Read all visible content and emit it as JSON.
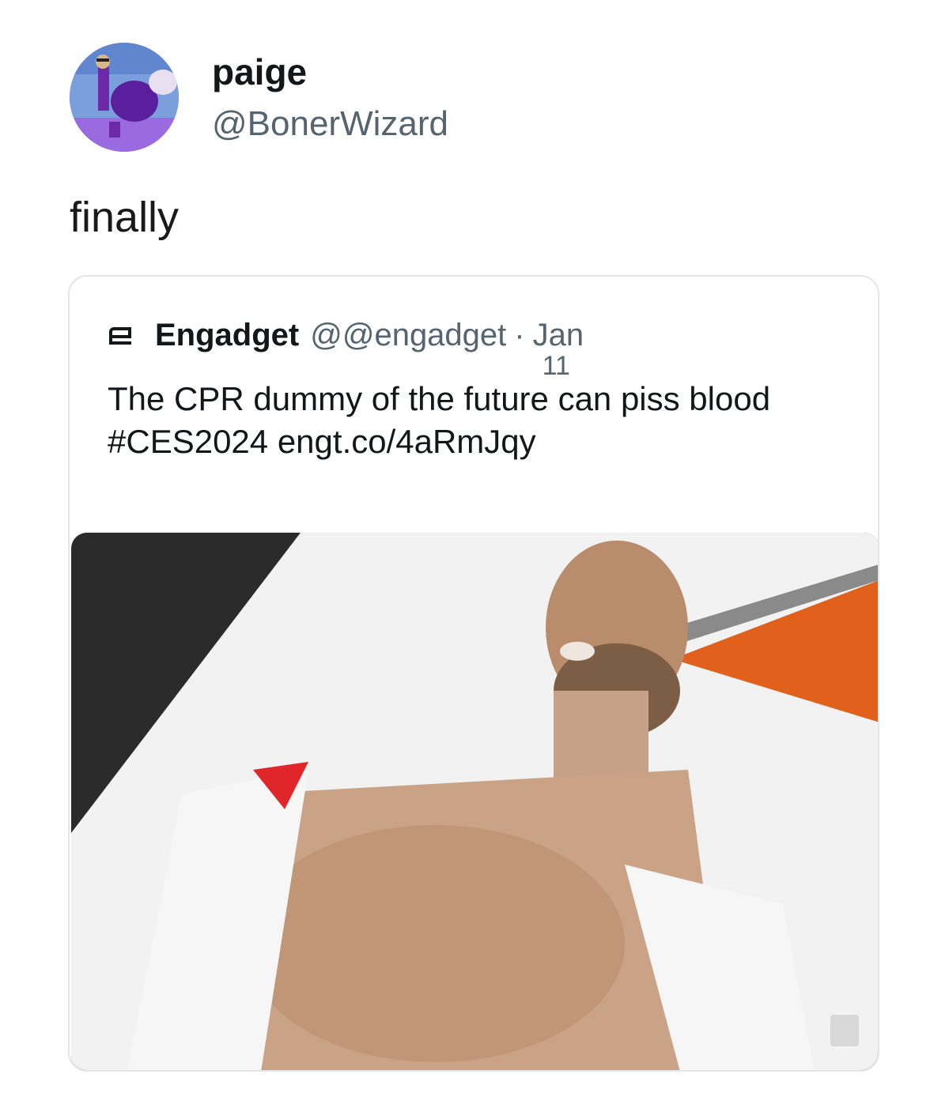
{
  "tweet": {
    "author": {
      "display_name": "paige",
      "handle": "@BonerWizard"
    },
    "text": "finally"
  },
  "quoted_tweet": {
    "source_name": "Engadget",
    "handle": "@@engadget",
    "separator": "·",
    "date_line1": "Jan",
    "date_line2": "11",
    "body": "The CPR dummy of the future can piss blood #CES2024 engt.co/4aRmJqy",
    "media": {
      "watermark_icon": "engadget-logo-icon"
    }
  },
  "colors": {
    "name": "#14171a",
    "secondary": "#56646f",
    "card_border": "#e3e6e9"
  }
}
